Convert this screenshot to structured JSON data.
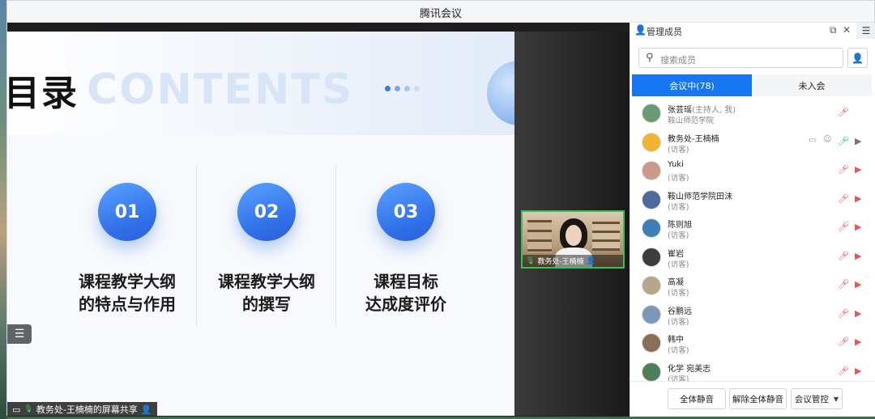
{
  "window": {
    "title": "腾讯会议"
  },
  "slide": {
    "title": "目录",
    "watermark": "CONTENTS",
    "items": [
      {
        "num": "01",
        "line1": "课程教学大纲",
        "line2": "的特点与作用"
      },
      {
        "num": "02",
        "line1": "课程教学大纲",
        "line2": "的撰写"
      },
      {
        "num": "03",
        "line1": "课程目标",
        "line2": "达成度评价"
      }
    ]
  },
  "video": {
    "label": "教务处-王楠楠"
  },
  "share_label": "教务处-王楠楠的屏幕共享",
  "panel": {
    "title": "管理成员",
    "search_placeholder": "搜索成员",
    "tabs": {
      "in_meeting": "会议中(78)",
      "not_joined": "未入会"
    },
    "members": [
      {
        "name": "张芸瑶",
        "tag": "(主持人, 我)",
        "sub": "鞍山师范学院",
        "avatar": "#6a9a73",
        "mic": "off",
        "cam": "none"
      },
      {
        "name": "教务处-王楠楠",
        "tag": "",
        "sub": "(访客)",
        "avatar": "#f2b233",
        "mic": "on",
        "cam": "on"
      },
      {
        "name": "Yuki",
        "tag": "",
        "sub": "(访客)",
        "avatar": "#c99a8a",
        "mic": "off",
        "cam": "off"
      },
      {
        "name": "鞍山师范学院田沫",
        "tag": "",
        "sub": "(访客)",
        "avatar": "#4d6a9c",
        "mic": "off",
        "cam": "off"
      },
      {
        "name": "陈则旭",
        "tag": "",
        "sub": "(访客)",
        "avatar": "#3b7fb5",
        "mic": "off",
        "cam": "off"
      },
      {
        "name": "崔岩",
        "tag": "",
        "sub": "(访客)",
        "avatar": "#3d3d3d",
        "mic": "off",
        "cam": "off"
      },
      {
        "name": "高凝",
        "tag": "",
        "sub": "(访客)",
        "avatar": "#b7a78a",
        "mic": "off",
        "cam": "off"
      },
      {
        "name": "谷鹏远",
        "tag": "",
        "sub": "(访客)",
        "avatar": "#7c98b8",
        "mic": "off",
        "cam": "off"
      },
      {
        "name": "韩中",
        "tag": "",
        "sub": "(访客)",
        "avatar": "#8a6e5a",
        "mic": "off",
        "cam": "off"
      },
      {
        "name": "化学 宛美志",
        "tag": "",
        "sub": "(访客)",
        "avatar": "#4f7e5a",
        "mic": "off",
        "cam": "off"
      }
    ],
    "footer": {
      "mute_all": "全体静音",
      "unmute_all": "解除全体静音",
      "control": "会议管控"
    }
  }
}
